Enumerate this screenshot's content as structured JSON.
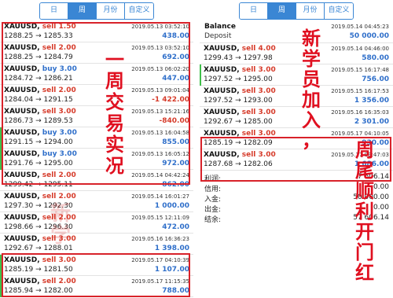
{
  "left": {
    "tabs": [
      {
        "label": "日",
        "active": false
      },
      {
        "label": "周",
        "active": true
      },
      {
        "label": "月份",
        "active": false
      },
      {
        "label": "自定义",
        "active": false
      }
    ],
    "rows": [
      {
        "symbol": "XAUUSD,",
        "side": "sell",
        "vol": "1.50",
        "prices": "1288.25 → 1285.33",
        "date": "2019.05.13 03:52:10",
        "profit": "438.00",
        "sign": "pos"
      },
      {
        "symbol": "XAUUSD,",
        "side": "sell",
        "vol": "2.00",
        "prices": "1288.25 → 1284.79",
        "date": "2019.05.13 03:52:10",
        "profit": "692.00",
        "sign": "pos"
      },
      {
        "symbol": "XAUUSD,",
        "side": "buy",
        "vol": "3.00",
        "prices": "1284.72 → 1286.21",
        "date": "2019.05.13 06:02:20",
        "profit": "447.00",
        "sign": "pos"
      },
      {
        "symbol": "XAUUSD,",
        "side": "sell",
        "vol": "2.00",
        "prices": "1284.04 → 1291.15",
        "date": "2019.05.13 09:01:04",
        "profit": "-1 422.00",
        "sign": "neg"
      },
      {
        "symbol": "XAUUSD,",
        "side": "sell",
        "vol": "3.00",
        "prices": "1286.73 → 1289.53",
        "date": "2019.05.13 15:21:16",
        "profit": "-840.00",
        "sign": "neg"
      },
      {
        "symbol": "XAUUSD,",
        "side": "buy",
        "vol": "3.00",
        "prices": "1291.15 → 1294.00",
        "date": "2019.05.13 16:04:58",
        "profit": "855.00",
        "sign": "pos"
      },
      {
        "symbol": "XAUUSD,",
        "side": "buy",
        "vol": "3.00",
        "prices": "1291.76 → 1295.00",
        "date": "2019.05.13 16:05:12",
        "profit": "972.00",
        "sign": "pos"
      },
      {
        "symbol": "XAUUSD,",
        "side": "sell",
        "vol": "2.00",
        "prices": "1299.42 → 1295.11",
        "date": "2019.05.14 04:42:24",
        "profit": "862.00",
        "sign": "pos"
      },
      {
        "symbol": "XAUUSD,",
        "side": "sell",
        "vol": "2.00",
        "prices": "1297.30 → 1292.30",
        "date": "2019.05.14 16:01:27",
        "profit": "1 000.00",
        "sign": "pos"
      },
      {
        "symbol": "XAUUSD,",
        "side": "sell",
        "vol": "2.00",
        "prices": "1298.66 → 1296.30",
        "date": "2019.05.15 12:11:09",
        "profit": "472.00",
        "sign": "pos"
      },
      {
        "symbol": "XAUUSD,",
        "side": "sell",
        "vol": "3.00",
        "prices": "1292.67 → 1288.01",
        "date": "2019.05.16 16:36:23",
        "profit": "1 398.00",
        "sign": "pos"
      },
      {
        "symbol": "XAUUSD,",
        "side": "sell",
        "vol": "3.00",
        "prices": "1285.19 → 1281.50",
        "date": "2019.05.17 04:10:39",
        "profit": "1 107.00",
        "sign": "pos"
      },
      {
        "symbol": "XAUUSD,",
        "side": "sell",
        "vol": "2.00",
        "prices": "1285.94 → 1282.00",
        "date": "2019.05.17 11:15:35",
        "profit": "788.00",
        "sign": "pos"
      }
    ],
    "caption": "一\n周\n交\n易\n实\n况",
    "watermark": "新\n学"
  },
  "right": {
    "tabs": [
      {
        "label": "日",
        "active": false
      },
      {
        "label": "周",
        "active": true
      },
      {
        "label": "月份",
        "active": false
      },
      {
        "label": "自定义",
        "active": false
      }
    ],
    "balance": {
      "title": "Balance",
      "subtitle": "Deposit",
      "date": "2019.05.14 04:45:23",
      "amount": "50 000.00"
    },
    "rows": [
      {
        "symbol": "XAUUSD,",
        "side": "sell",
        "vol": "4.00",
        "prices": "1299.43 → 1297.98",
        "date": "2019.05.14 04:46:00",
        "profit": "580.00",
        "sign": "pos"
      },
      {
        "symbol": "XAUUSD,",
        "side": "sell",
        "vol": "3.00",
        "prices": "1297.52 → 1295.00",
        "date": "2019.05.15 16:17:48",
        "profit": "756.00",
        "sign": "pos"
      },
      {
        "symbol": "XAUUSD,",
        "side": "sell",
        "vol": "3.00",
        "prices": "1297.52 → 1293.00",
        "date": "2019.05.15 16:17:53",
        "profit": "1 356.00",
        "sign": "pos"
      },
      {
        "symbol": "XAUUSD,",
        "side": "sell",
        "vol": "3.00",
        "prices": "1292.67 → 1285.00",
        "date": "2019.05.16 16:35:03",
        "profit": "2 301.00",
        "sign": "pos"
      },
      {
        "symbol": "XAUUSD,",
        "side": "sell",
        "vol": "3.00",
        "prices": "1285.19 → 1282.09",
        "date": "2019.05.17 04:10:05",
        "profit": "930.00",
        "sign": "pos"
      },
      {
        "symbol": "XAUUSD,",
        "side": "sell",
        "vol": "3.00",
        "prices": "1287.68 → 1282.06",
        "date": "2019.05.17 09:47:03",
        "profit": "1 686.00",
        "sign": "pos"
      }
    ],
    "summary": [
      {
        "label": "利润:",
        "value": "7 606.14"
      },
      {
        "label": "信用:",
        "value": "0.00"
      },
      {
        "label": "入金:",
        "value": "50 000.00"
      },
      {
        "label": "出金:",
        "value": "0.00"
      },
      {
        "label": "结余:",
        "value": "57 606.14"
      }
    ],
    "caption1": "新\n学\n员\n加\n入\n，",
    "caption2": "周\n尾\n顺\n利\n开\n门\n红"
  },
  "colors": {
    "accent": "#3a86d4",
    "sell": "#d63b2a",
    "buy": "#2f6fca",
    "box": "#d8222a",
    "caption": "#e01020"
  }
}
